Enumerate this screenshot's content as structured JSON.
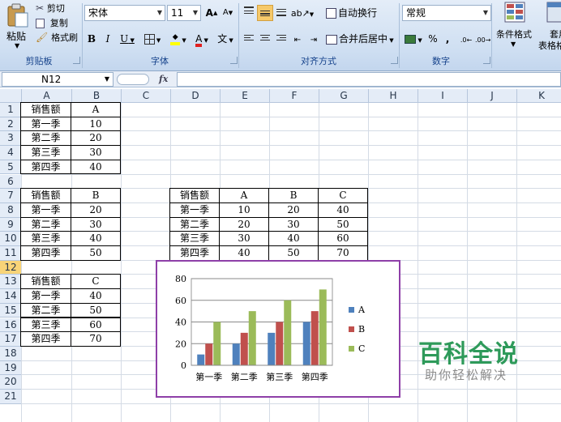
{
  "ribbon": {
    "clipboard": {
      "paste": "粘贴",
      "cut": "剪切",
      "copy": "复制",
      "format_painter": "格式刷",
      "group_label": "剪贴板"
    },
    "font": {
      "name": "宋体",
      "size": "11",
      "grow": "A",
      "shrink": "A",
      "bold": "B",
      "italic": "I",
      "underline": "U",
      "font_color_letter": "A",
      "phonetic": "文",
      "group_label": "字体"
    },
    "alignment": {
      "wrap_text": "自动换行",
      "merge_center": "合并后居中",
      "group_label": "对齐方式"
    },
    "number": {
      "format": "常规",
      "percent": "%",
      "comma": ",",
      "group_label": "数字"
    },
    "styles": {
      "conditional": "条件格式",
      "table_format": "套用",
      "table_format2": "表格格"
    }
  },
  "formula_bar": {
    "name_box": "N12",
    "fx": "fx",
    "formula": ""
  },
  "columns": [
    "A",
    "B",
    "C",
    "D",
    "E",
    "F",
    "G",
    "H",
    "I",
    "J",
    "K"
  ],
  "rows": [
    "1",
    "2",
    "3",
    "4",
    "5",
    "6",
    "7",
    "8",
    "9",
    "10",
    "11",
    "12",
    "13",
    "14",
    "15",
    "16",
    "17",
    "18",
    "19",
    "20",
    "21"
  ],
  "selected_row": "12",
  "tables": {
    "t1": {
      "header": [
        "销售额",
        "A"
      ],
      "rows": [
        [
          "第一季",
          "10"
        ],
        [
          "第二季",
          "20"
        ],
        [
          "第三季",
          "30"
        ],
        [
          "第四季",
          "40"
        ]
      ]
    },
    "t2": {
      "header": [
        "销售额",
        "B"
      ],
      "rows": [
        [
          "第一季",
          "20"
        ],
        [
          "第二季",
          "30"
        ],
        [
          "第三季",
          "40"
        ],
        [
          "第四季",
          "50"
        ]
      ]
    },
    "t3": {
      "header": [
        "销售额",
        "C"
      ],
      "rows": [
        [
          "第一季",
          "40"
        ],
        [
          "第二季",
          "50"
        ],
        [
          "第三季",
          "60"
        ],
        [
          "第四季",
          "70"
        ]
      ]
    },
    "t4": {
      "header": [
        "销售额",
        "A",
        "B",
        "C"
      ],
      "rows": [
        [
          "第一季",
          "10",
          "20",
          "40"
        ],
        [
          "第二季",
          "20",
          "30",
          "50"
        ],
        [
          "第三季",
          "30",
          "40",
          "60"
        ],
        [
          "第四季",
          "40",
          "50",
          "70"
        ]
      ]
    }
  },
  "chart_data": {
    "type": "bar",
    "categories": [
      "第一季",
      "第二季",
      "第三季",
      "第四季"
    ],
    "series": [
      {
        "name": "A",
        "values": [
          10,
          20,
          30,
          40
        ],
        "color": "#4f81bd"
      },
      {
        "name": "B",
        "values": [
          20,
          30,
          40,
          50
        ],
        "color": "#c0504d"
      },
      {
        "name": "C",
        "values": [
          40,
          50,
          60,
          70
        ],
        "color": "#9bbb59"
      }
    ],
    "ylim": [
      0,
      80
    ],
    "yticks": [
      0,
      20,
      40,
      60,
      80
    ],
    "grid": true,
    "legend": "right"
  },
  "watermark": {
    "title": "百科全说",
    "subtitle": "助你轻松解决"
  }
}
